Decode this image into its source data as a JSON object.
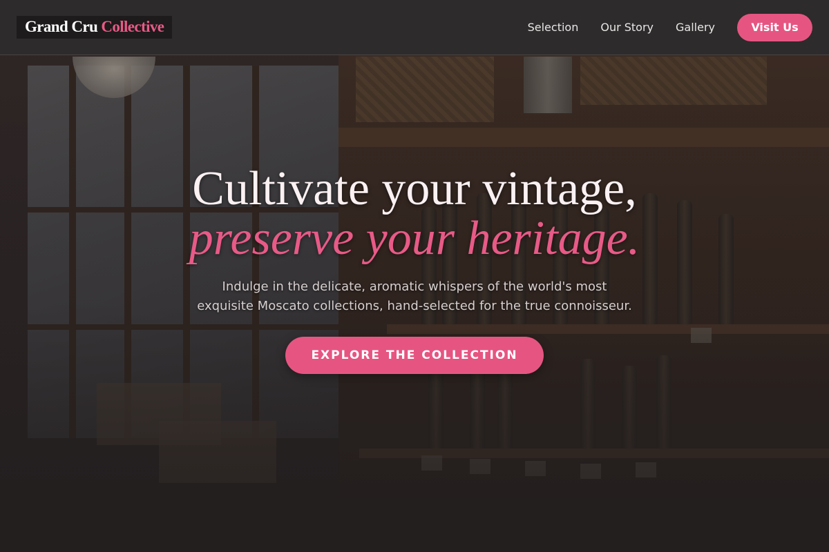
{
  "brand": {
    "name_primary": "Grand Cru",
    "name_accent": "Collective",
    "accent_color": "#e85a87"
  },
  "nav": {
    "links": [
      {
        "label": "Selection"
      },
      {
        "label": "Our Story"
      },
      {
        "label": "Gallery"
      }
    ],
    "cta_label": "Visit Us"
  },
  "hero": {
    "title_line1": "Cultivate your vintage,",
    "title_line2": "preserve your heritage.",
    "subtitle": "Indulge in the delicate, aromatic whispers of the world's most exquisite Moscato collections, hand-selected for the true connoisseur.",
    "cta_label": "EXPLORE THE COLLECTION"
  },
  "colors": {
    "button": "#e65582",
    "header_bg": "#2d2b2b",
    "title_text": "#fbf1f3"
  }
}
